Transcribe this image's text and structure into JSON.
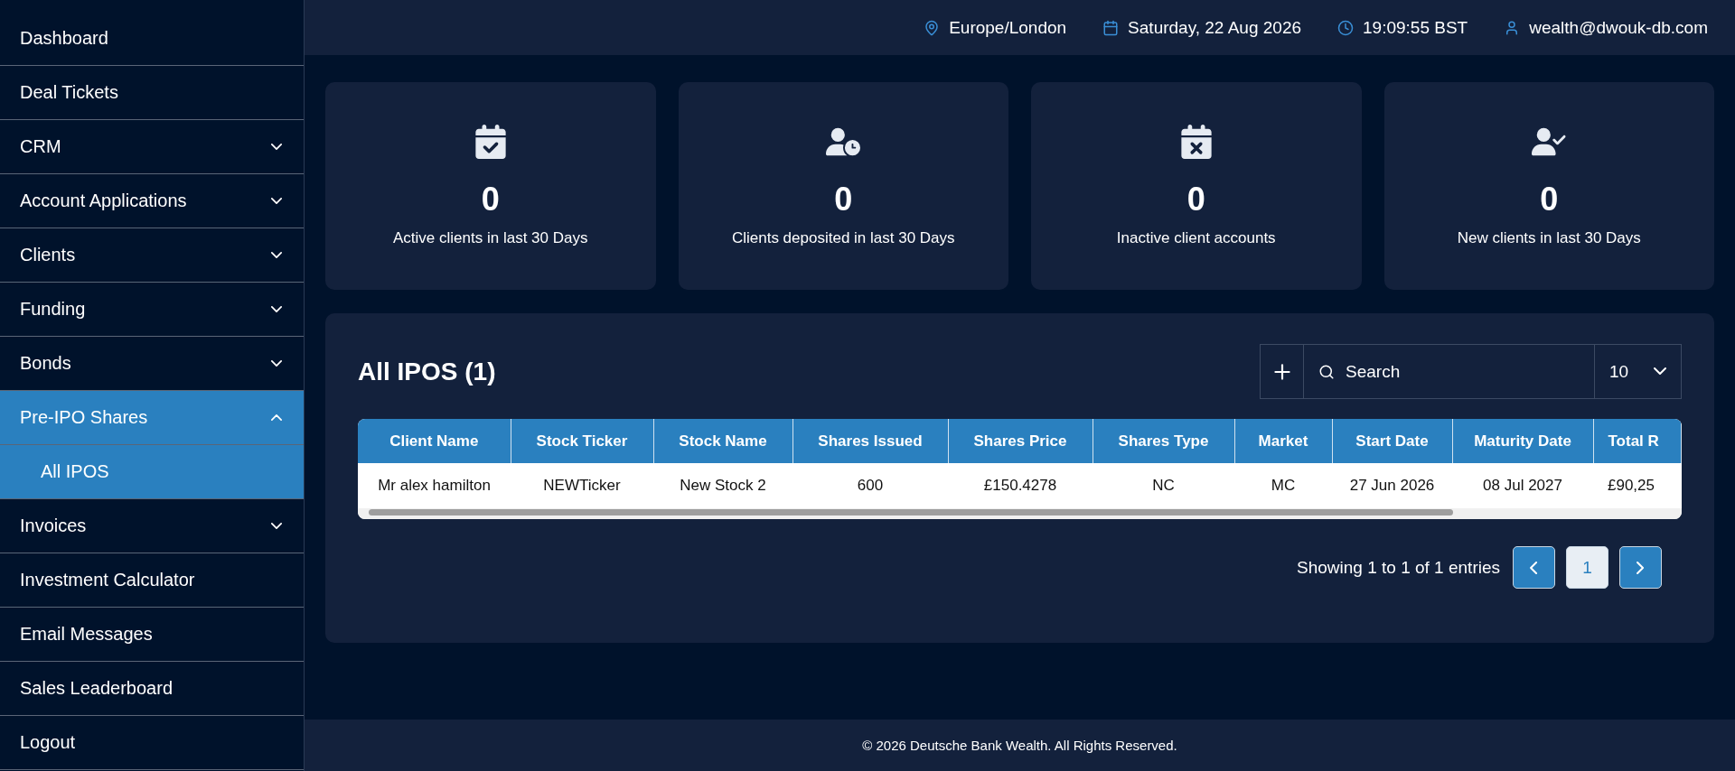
{
  "sidebar": {
    "items": [
      {
        "label": "Dashboard",
        "selected": false
      },
      {
        "label": "Deal Tickets",
        "selected": false
      },
      {
        "label": "CRM",
        "expanded": false
      },
      {
        "label": "Account Applications",
        "expanded": false
      },
      {
        "label": "Clients",
        "expanded": false
      },
      {
        "label": "Funding",
        "expanded": false
      },
      {
        "label": "Bonds",
        "expanded": false
      },
      {
        "label": "Pre-IPO Shares",
        "expanded": true,
        "children": [
          {
            "label": "All IPOS",
            "selected": true
          }
        ]
      },
      {
        "label": "Invoices",
        "expanded": false
      },
      {
        "label": "Investment Calculator",
        "selected": false
      },
      {
        "label": "Email Messages",
        "selected": false
      },
      {
        "label": "Sales Leaderboard",
        "selected": false
      },
      {
        "label": "Logout",
        "selected": false
      }
    ]
  },
  "top_bar": {
    "timezone": "Europe/London",
    "date": "Saturday, 22 Aug 2026",
    "time": "19:09:55 BST",
    "user": "wealth@dwouk-db.com"
  },
  "stats": [
    {
      "value": "0",
      "label": "Active clients in last 30 Days"
    },
    {
      "value": "0",
      "label": "Clients deposited in last 30 Days"
    },
    {
      "value": "0",
      "label": "Inactive client accounts"
    },
    {
      "value": "0",
      "label": "New clients in last 30 Days"
    }
  ],
  "ipos": {
    "title": "All IPOS (1)",
    "search": {
      "placeholder": "Search"
    },
    "page_size": "10",
    "table": {
      "columns": [
        "Client Name",
        "Stock Ticker",
        "Stock Name",
        "Shares Issued",
        "Shares Price",
        "Shares Type",
        "Market",
        "Start Date",
        "Maturity Date",
        "Total R"
      ],
      "rows": [
        [
          "Mr alex hamilton",
          "NEWTicker",
          "New Stock 2",
          "600",
          "£150.4278",
          "NC",
          "MC",
          "27 Jun 2026",
          "08 Jul 2027",
          "£90,25"
        ]
      ]
    },
    "entries": "Showing 1 to 1 of 1 entries",
    "pages": [
      {
        "label": "1",
        "selected": true
      }
    ]
  },
  "footer": "© 2026 Deutsche Bank Wealth. All Rights Reserved."
}
